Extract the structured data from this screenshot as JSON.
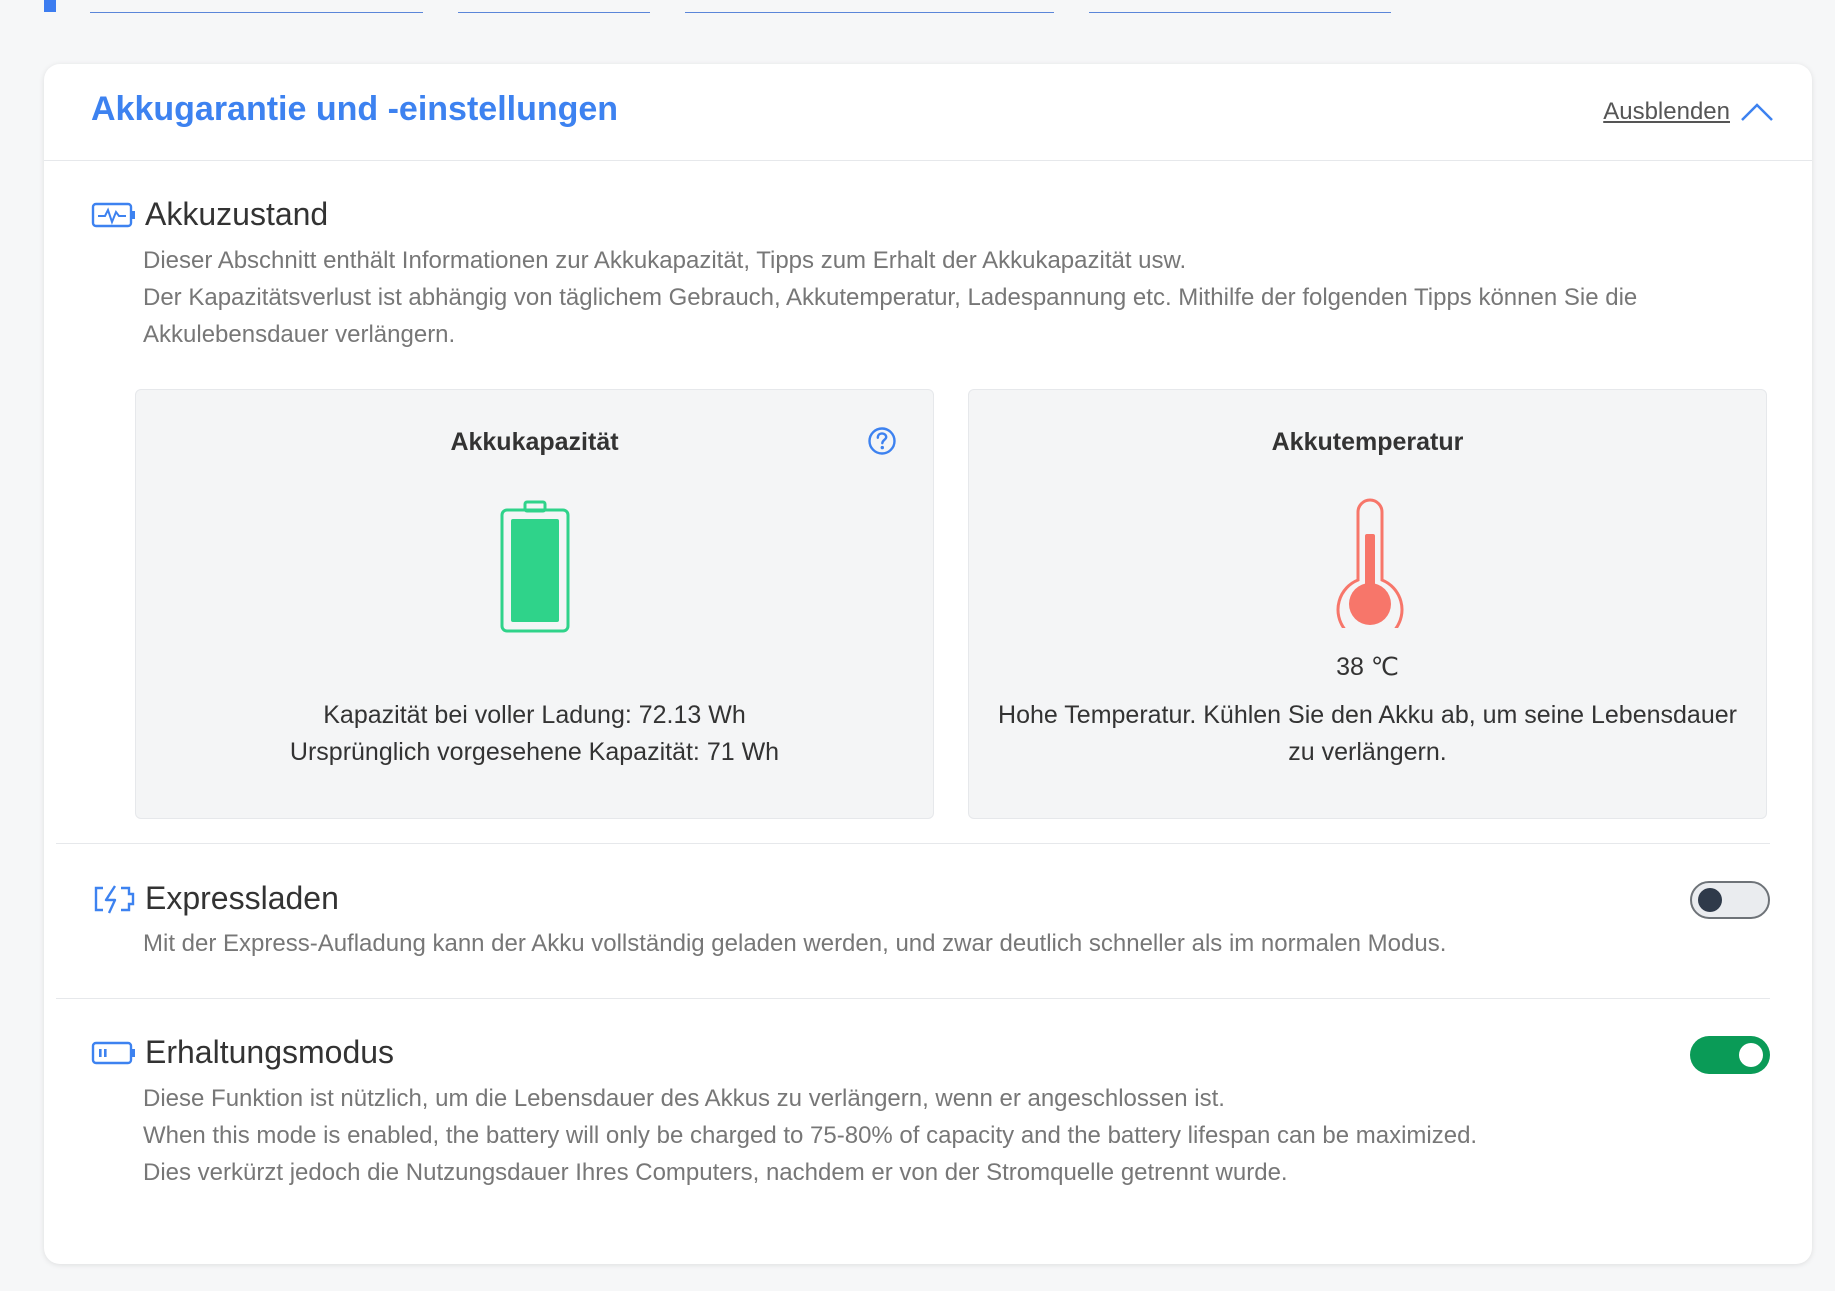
{
  "card": {
    "title": "Akkugarantie und -einstellungen",
    "hide_label": "Ausblenden",
    "collapse_icon": "chevron-up-icon"
  },
  "battery_health": {
    "icon": "battery-pulse-icon",
    "title": "Akkuzustand",
    "description": [
      "Dieser Abschnitt enthält Informationen zur Akkukapazität, Tipps zum Erhalt der Akkukapazität usw.",
      "Der Kapazitätsverlust ist abhängig von täglichem Gebrauch, Akkutemperatur, Ladespannung etc. Mithilfe der folgenden Tipps können Sie die",
      "Akkulebensdauer verlängern."
    ],
    "capacity_panel": {
      "title": "Akkukapazität",
      "help_icon": "question-circle-icon",
      "icon": "battery-full-icon",
      "full_charge": "Kapazität bei voller Ladung: 72.13 Wh",
      "design_capacity": "Ursprünglich vorgesehene Kapazität: 71 Wh",
      "color": "#2fd38a"
    },
    "temperature_panel": {
      "title": "Akkutemperatur",
      "icon": "thermometer-icon",
      "value": "38 ℃",
      "message_line1": "Hohe Temperatur. Kühlen Sie den Akku ab, um seine Lebensdauer",
      "message_line2": "zu verlängern.",
      "color": "#f7766a"
    }
  },
  "express_charge": {
    "icon": "lightning-charge-icon",
    "title": "Expressladen",
    "description": "Mit der Express-Aufladung kann der Akku vollständig geladen werden, und zwar deutlich schneller als im normalen Modus.",
    "enabled": false
  },
  "maintenance_mode": {
    "icon": "battery-low-icon",
    "title": "Erhaltungsmodus",
    "description": [
      "Diese Funktion ist nützlich, um die Lebensdauer des Akkus zu verlängern, wenn er angeschlossen ist.",
      "When this mode is enabled, the battery will only be charged to 75-80% of capacity and the battery lifespan can be maximized.",
      "Dies verkürzt jedoch die Nutzungsdauer Ihres Computers, nachdem er von der Stromquelle getrennt wurde."
    ],
    "enabled": true
  },
  "colors": {
    "accent": "#3d82f0",
    "toggle_on": "#0a9b57"
  }
}
